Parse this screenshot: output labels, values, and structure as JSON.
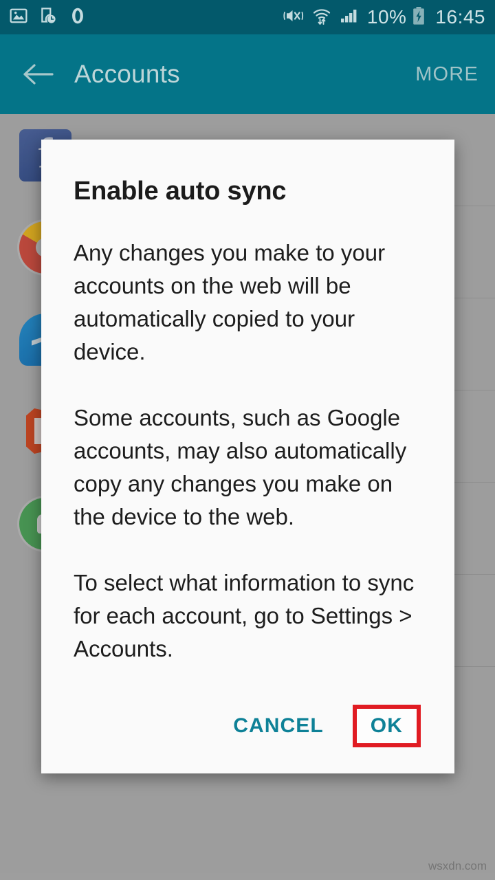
{
  "status_bar": {
    "background_color": "#03596b",
    "left_icons": [
      {
        "name": "screenshot-icon",
        "label": "screenshot"
      },
      {
        "name": "device-clock-icon",
        "label": "scheduled-device"
      },
      {
        "name": "opera-logo-icon",
        "label": "opera"
      }
    ],
    "right_icons": [
      {
        "name": "mute-vibrate-icon",
        "label": "sound off / vibrate"
      },
      {
        "name": "wifi-transfer-icon",
        "label": "wifi with data transfer"
      },
      {
        "name": "signal-bars-icon",
        "label": "cellular signal"
      }
    ],
    "battery_percent": "10%",
    "battery_state": "charging",
    "clock": "16:45"
  },
  "app_bar": {
    "background_color": "#047488",
    "title": "Accounts",
    "back_icon": "arrow-left-icon",
    "more_label": "MORE"
  },
  "background_list": {
    "accounts": [
      {
        "name": "facebook",
        "icon": "facebook-icon"
      },
      {
        "name": "google",
        "icon": "google-icon"
      },
      {
        "name": "messenger",
        "icon": "messenger-icon"
      },
      {
        "name": "microsoft-office",
        "icon": "office-icon"
      },
      {
        "name": "whatsapp",
        "icon": "whatsapp-icon"
      }
    ]
  },
  "dialog": {
    "title": "Enable auto sync",
    "paragraphs": [
      "Any changes you make to your accounts on the web will be automatically copied to your device.",
      "Some accounts, such as Google accounts, may also automatically copy any changes you make on the device to the web.",
      "To select what information to sync for each account, go to Settings > Accounts."
    ],
    "cancel_label": "CANCEL",
    "ok_label": "OK",
    "action_color": "#0e8197",
    "highlight_color": "#e01b22",
    "highlighted_button": "OK"
  },
  "watermark": "wsxdn.com"
}
